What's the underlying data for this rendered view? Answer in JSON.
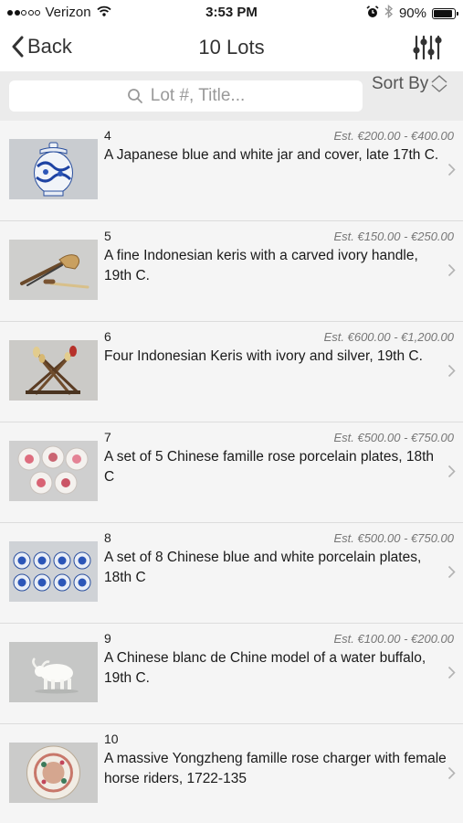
{
  "status_bar": {
    "carrier": "Verizon",
    "time": "3:53 PM",
    "battery": "90%",
    "battery_level": 0.9,
    "signal_bars_filled": 2,
    "signal_bars_total": 5,
    "icons": [
      "wifi-icon",
      "alarm-icon",
      "bluetooth-icon",
      "battery-icon"
    ]
  },
  "nav": {
    "back_label": "Back",
    "title": "10 Lots",
    "filter_icon": "sliders-icon"
  },
  "search": {
    "placeholder": "Lot #, Title...",
    "sort_label": "Sort By"
  },
  "lots": [
    {
      "number": "4",
      "estimate": "Est. €200.00 - €400.00",
      "title": "A Japanese blue and white jar and cover, late 17th C.",
      "thumb": "blue-white-jar"
    },
    {
      "number": "5",
      "estimate": "Est. €150.00 - €250.00",
      "title": "A fine Indonesian keris with a carved ivory handle, 19th C.",
      "thumb": "keris"
    },
    {
      "number": "6",
      "estimate": "Est. €600.00 - €1,200.00",
      "title": "Four Indonesian Keris with ivory and silver, 19th C.",
      "thumb": "four-keris"
    },
    {
      "number": "7",
      "estimate": "Est. €500.00 - €750.00",
      "title": "A set of 5 Chinese famille rose porcelain plates, 18th C",
      "thumb": "famille-rose-plates"
    },
    {
      "number": "8",
      "estimate": "Est. €500.00 - €750.00",
      "title": "A set of 8 Chinese blue and white porcelain plates, 18th C",
      "thumb": "blue-white-plates"
    },
    {
      "number": "9",
      "estimate": "Est. €100.00 - €200.00",
      "title": "A Chinese blanc de Chine model of a water buffalo, 19th C.",
      "thumb": "water-buffalo"
    },
    {
      "number": "10",
      "estimate": "",
      "title": "A massive Yongzheng famille rose charger with female horse riders, 1722-135",
      "thumb": "charger"
    }
  ],
  "colors": {
    "background": "#f5f5f5",
    "search_area": "#ebebeb",
    "text": "#1a1a1a",
    "estimate": "#777777",
    "chevron": "#b3b3b3"
  }
}
